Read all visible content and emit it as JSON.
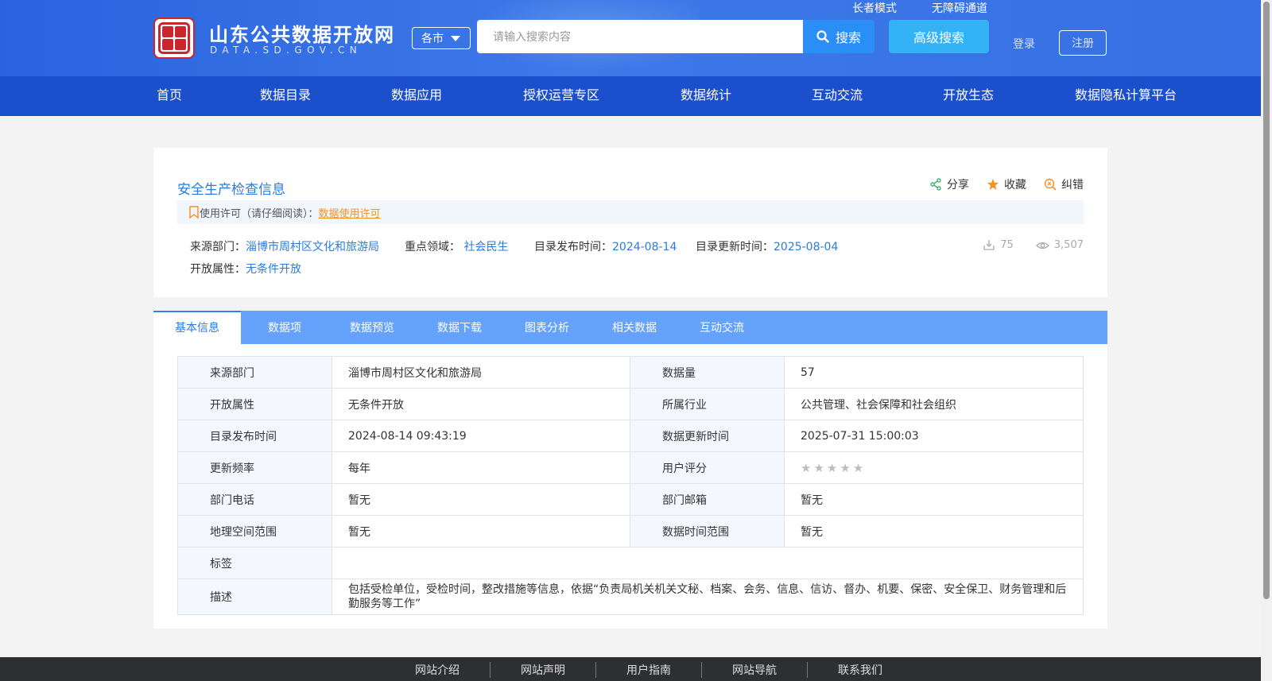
{
  "header": {
    "site_name": "山东公共数据开放网",
    "site_domain": "DATA.SD.GOV.CN",
    "city_select": "各市",
    "search_placeholder": "请输入搜索内容",
    "search_button": "搜索",
    "advanced_search": "高级搜索",
    "elder_mode": "长者模式",
    "accessibility": "无障碍通道",
    "login": "登录",
    "register": "注册"
  },
  "nav": {
    "items": [
      "首页",
      "数据目录",
      "数据应用",
      "授权运营专区",
      "数据统计",
      "互动交流",
      "开放生态",
      "数据隐私计算平台"
    ]
  },
  "detail": {
    "title": "安全生产检查信息",
    "actions": {
      "share": "分享",
      "favorite": "收藏",
      "correct": "纠错"
    },
    "license_label": "使用许可（请仔细阅读）：",
    "license_link": "数据使用许可",
    "meta": {
      "source_label": "来源部门：",
      "source_value": "淄博市周村区文化和旅游局",
      "field_label": "重点领域：",
      "field_value": "社会民生",
      "publish_label": "目录发布时间：",
      "publish_value": "2024-08-14",
      "update_label": "目录更新时间：",
      "update_value": "2025-08-04",
      "open_label": "开放属性：",
      "open_value": "无条件开放"
    },
    "stats": {
      "downloads": "75",
      "views": "3,507"
    }
  },
  "tabs": [
    "基本信息",
    "数据项",
    "数据预览",
    "数据下载",
    "图表分析",
    "相关数据",
    "互动交流"
  ],
  "info": {
    "rows": [
      {
        "l1": "来源部门",
        "v1": "淄博市周村区文化和旅游局",
        "l2": "数据量",
        "v2": "57"
      },
      {
        "l1": "开放属性",
        "v1": "无条件开放",
        "l2": "所属行业",
        "v2": "公共管理、社会保障和社会组织"
      },
      {
        "l1": "目录发布时间",
        "v1": "2024-08-14 09:43:19",
        "l2": "数据更新时间",
        "v2": "2025-07-31 15:00:03"
      },
      {
        "l1": "更新频率",
        "v1": "每年",
        "l2": "用户评分",
        "v2": ""
      },
      {
        "l1": "部门电话",
        "v1": "暂无",
        "l2": "部门邮箱",
        "v2": "暂无"
      },
      {
        "l1": "地理空间范围",
        "v1": "暂无",
        "l2": "数据时间范围",
        "v2": "暂无"
      }
    ],
    "rating": 0,
    "tags_label": "标签",
    "tags_value": "",
    "desc_label": "描述",
    "desc_value": "包括受检单位，受检时间，整改措施等信息，依据“负责局机关机关文秘、档案、会务、信息、信访、督办、机要、保密、安全保卫、财务管理和后勤服务等工作”"
  },
  "footer": {
    "links": [
      "网站介绍",
      "网站声明",
      "用户指南",
      "网站导航",
      "联系我们"
    ]
  }
}
